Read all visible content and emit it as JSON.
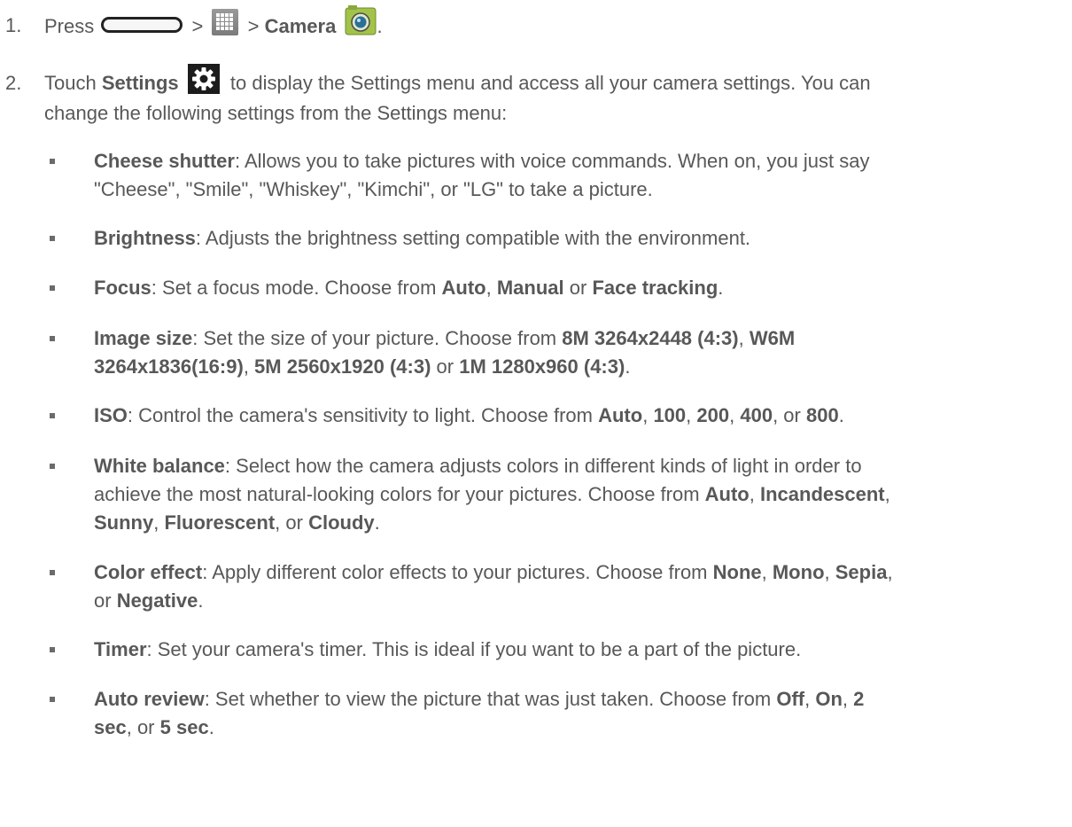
{
  "step1": {
    "number": "1.",
    "press": "Press",
    "sep1": ">",
    "sep2": ">",
    "camera_label": "Camera",
    "end": ".",
    "icons": [
      "home-button-icon",
      "apps-icon",
      "camera-app-icon"
    ]
  },
  "step2": {
    "number": "2.",
    "touch": "Touch",
    "settings_label": "Settings",
    "line1_rest": "to display the Settings menu and access all your camera settings. You can",
    "line2": "change the following settings from the Settings menu:",
    "icons": [
      "gear-icon"
    ]
  },
  "settings": {
    "cheese": {
      "term": "Cheese shutter",
      "l1": ": Allows you to take pictures with voice commands. When on, you just say",
      "l2": "\"Cheese\", \"Smile\", \"Whiskey\", \"Kimchi\", or \"LG\" to take a picture."
    },
    "brightness": {
      "term": "Brightness",
      "text": ": Adjusts the brightness setting compatible with the environment."
    },
    "focus": {
      "term": "Focus",
      "text": ": Set a focus mode. Choose from ",
      "o1": "Auto",
      "c1": ", ",
      "o2": "Manual",
      "c2": " or ",
      "o3": "Face tracking",
      "end": "."
    },
    "image_size": {
      "term": "Image size",
      "text": ": Set the size of your picture. Choose from ",
      "o1": "8M 3264x2448 (4:3)",
      "c1": ", ",
      "o2a": "W6M",
      "o2b": "3264x1836(16:9)",
      "c2": ", ",
      "o3": "5M 2560x1920 (4:3)",
      "c3": " or ",
      "o4": "1M 1280x960 (4:3)",
      "end": "."
    },
    "iso": {
      "term": "ISO",
      "text": ": Control the camera's sensitivity to light. Choose from ",
      "o1": "Auto",
      "c1": ", ",
      "o2": "100",
      "c2": ", ",
      "o3": "200",
      "c3": ", ",
      "o4": "400",
      "c4": ", or ",
      "o5": "800",
      "end": "."
    },
    "white_balance": {
      "term": "White balance",
      "l1": ": Select how the camera adjusts colors in different kinds of light in order to",
      "l2": "achieve the most natural-looking colors for your pictures. Choose from ",
      "o1": "Auto",
      "c1": ", ",
      "o2": "Incandescent",
      "c2": ",",
      "o3": "Sunny",
      "c3": ", ",
      "o4": "Fluorescent",
      "c4": ", or ",
      "o5": "Cloudy",
      "end": "."
    },
    "color_effect": {
      "term": "Color effect",
      "text": ": Apply different color effects to your pictures. Choose from ",
      "o1": "None",
      "c1": ", ",
      "o2": "Mono",
      "c2": ", ",
      "o3": "Sepia",
      "c3": ",",
      "l2_pre": "or ",
      "o4": "Negative",
      "end": "."
    },
    "timer": {
      "term": "Timer",
      "text": ": Set your camera's timer. This is ideal if you want to be a part of the picture."
    },
    "auto_review": {
      "term": "Auto review",
      "text": ": Set whether to view the picture that was just taken. Choose from ",
      "o1": "Off",
      "c1": ", ",
      "o2": "On",
      "c2": ", ",
      "o3a": "2",
      "o3b": "sec",
      "c3": ", or ",
      "o4": "5 sec",
      "end": "."
    }
  }
}
